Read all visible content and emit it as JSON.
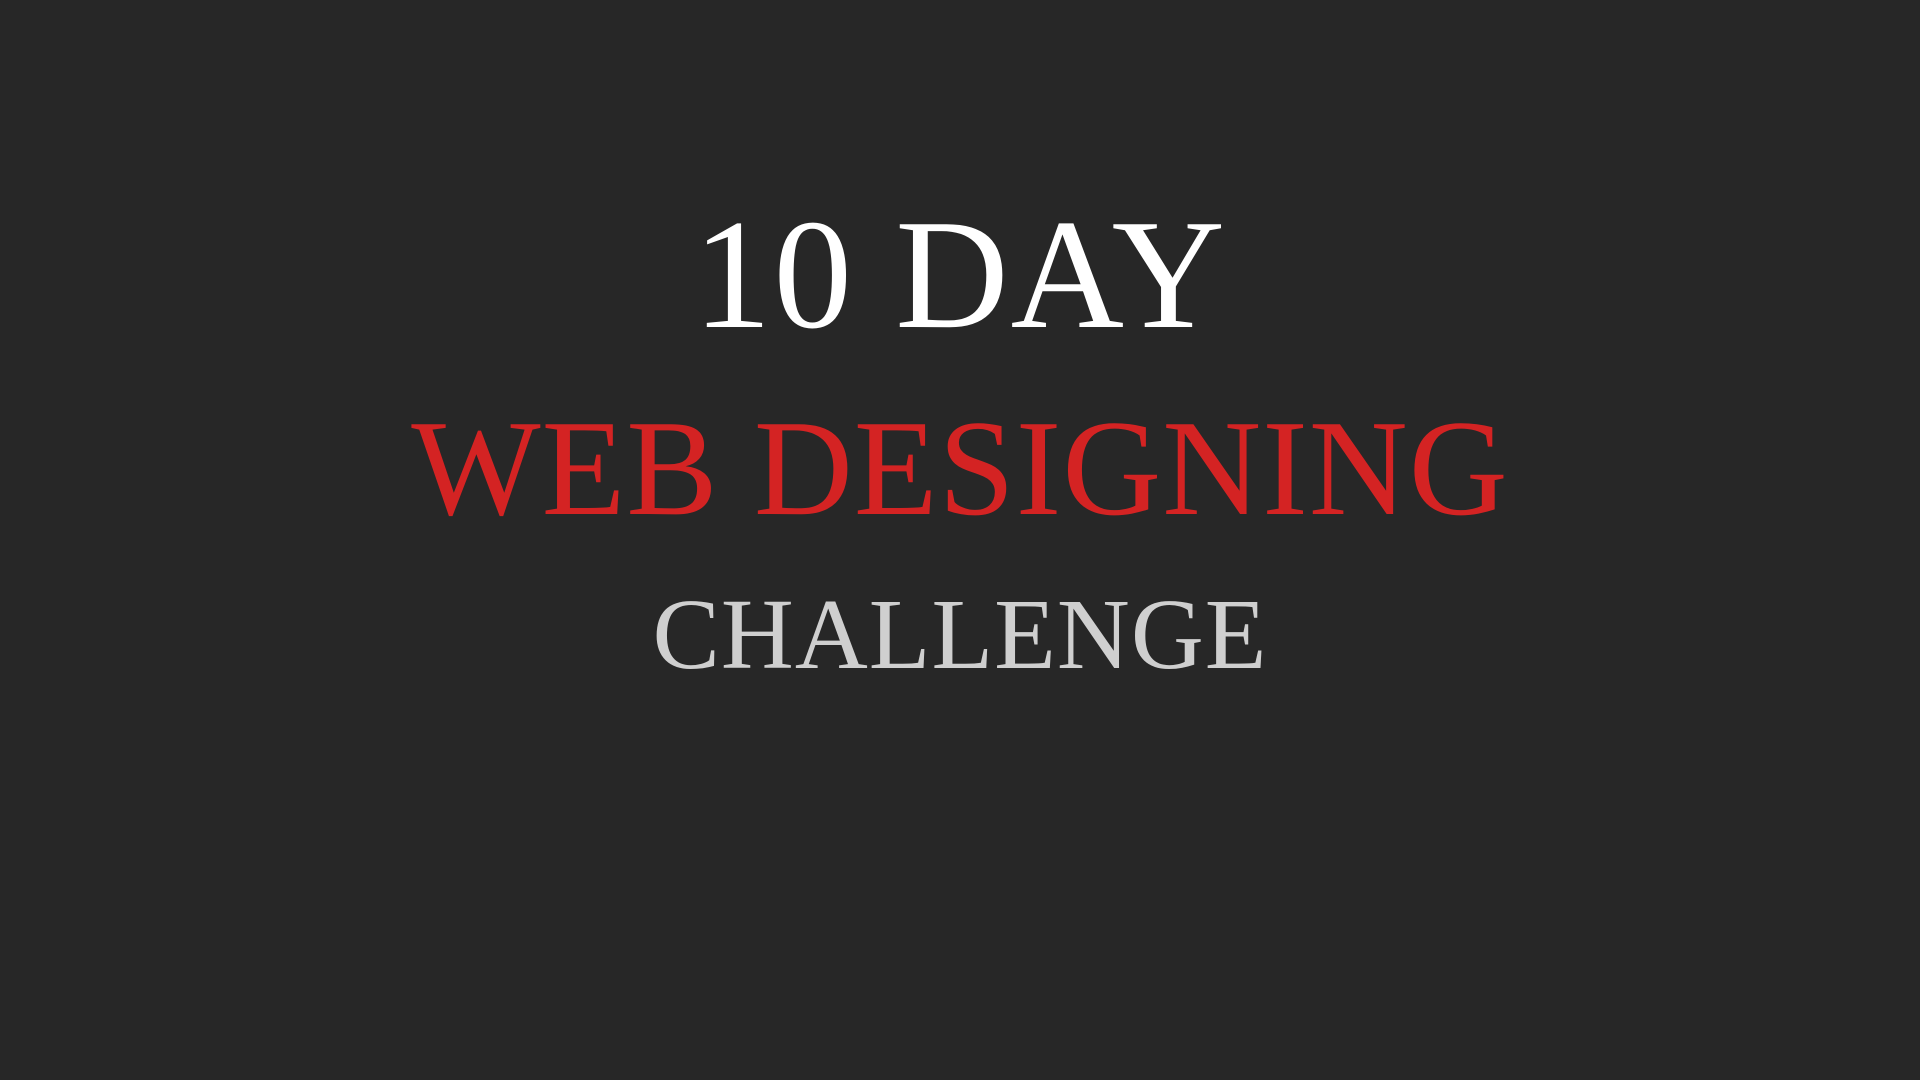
{
  "headline": {
    "line1": "10 DAY",
    "line2": "WEB DESIGNING",
    "line3": "CHALLENGE"
  },
  "colors": {
    "background": "#272727",
    "line1": "#ffffff",
    "line2": "#d42323",
    "line3": "#cfcfcf"
  }
}
